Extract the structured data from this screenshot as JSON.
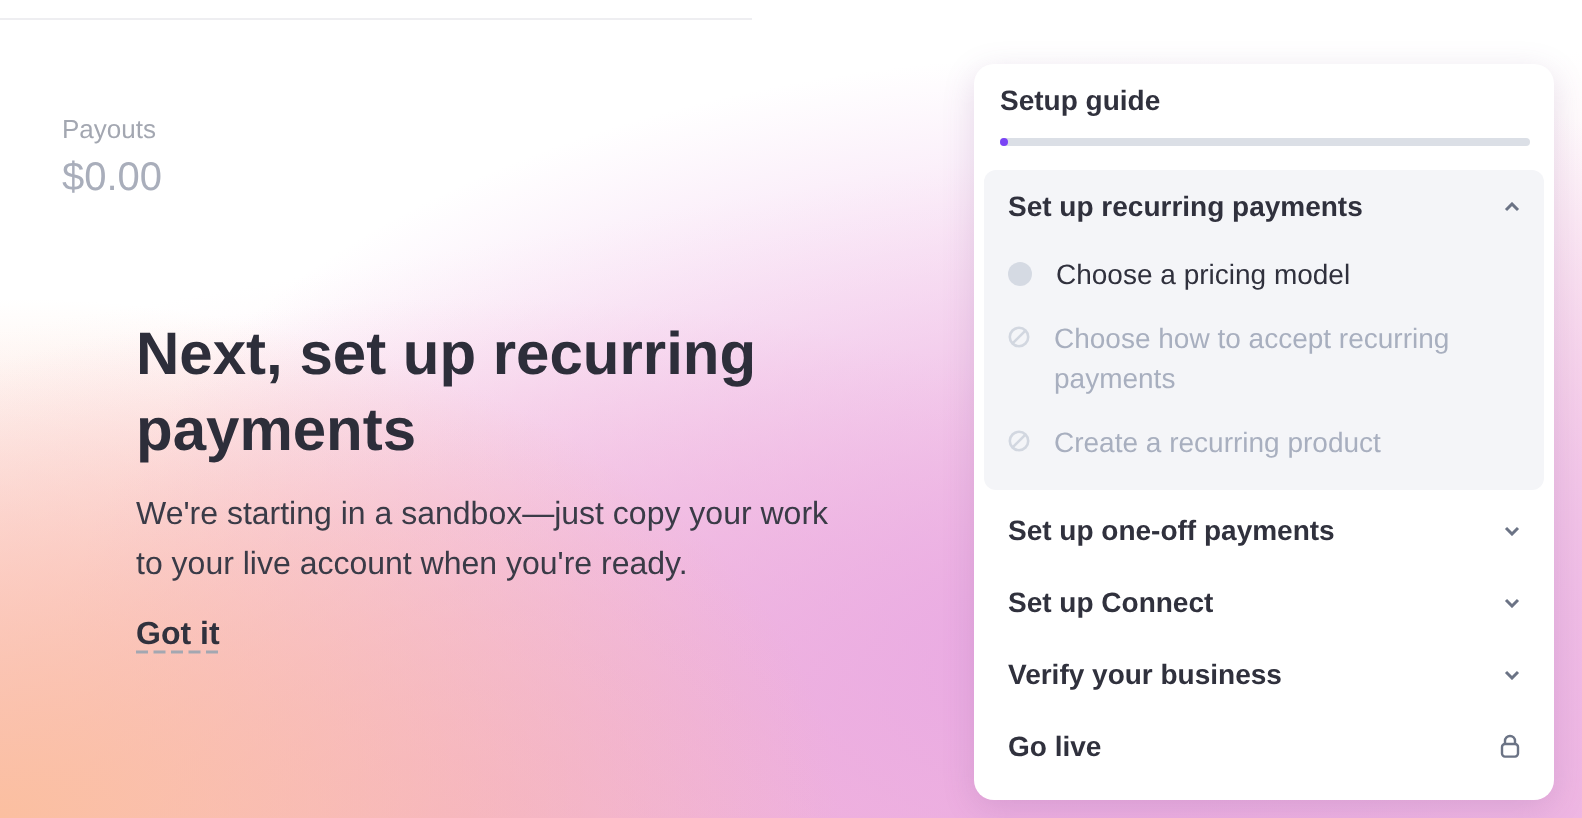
{
  "payouts": {
    "label": "Payouts",
    "amount": "$0.00"
  },
  "hero": {
    "title": "Next, set up recurring payments",
    "body": "We're starting in a sandbox—just copy your work to your live account when you're ready.",
    "link": "Got it"
  },
  "setup_guide": {
    "title": "Setup guide",
    "level": 0.01,
    "sections": [
      {
        "kind": "expandable",
        "title": "Set up recurring payments",
        "expanded": true,
        "steps": [
          {
            "label": "Choose a pricing model",
            "disabled": false
          },
          {
            "label": "Choose how to accept recurring payments",
            "disabled": true
          },
          {
            "label": "Create a recurring product",
            "disabled": true
          }
        ]
      },
      {
        "kind": "expandable",
        "title": "Set up one-off payments",
        "expanded": false
      },
      {
        "kind": "expandable",
        "title": "Set up Connect",
        "expanded": false
      },
      {
        "kind": "expandable",
        "title": "Verify your business",
        "expanded": false
      },
      {
        "kind": "locked",
        "title": "Go live"
      }
    ]
  }
}
